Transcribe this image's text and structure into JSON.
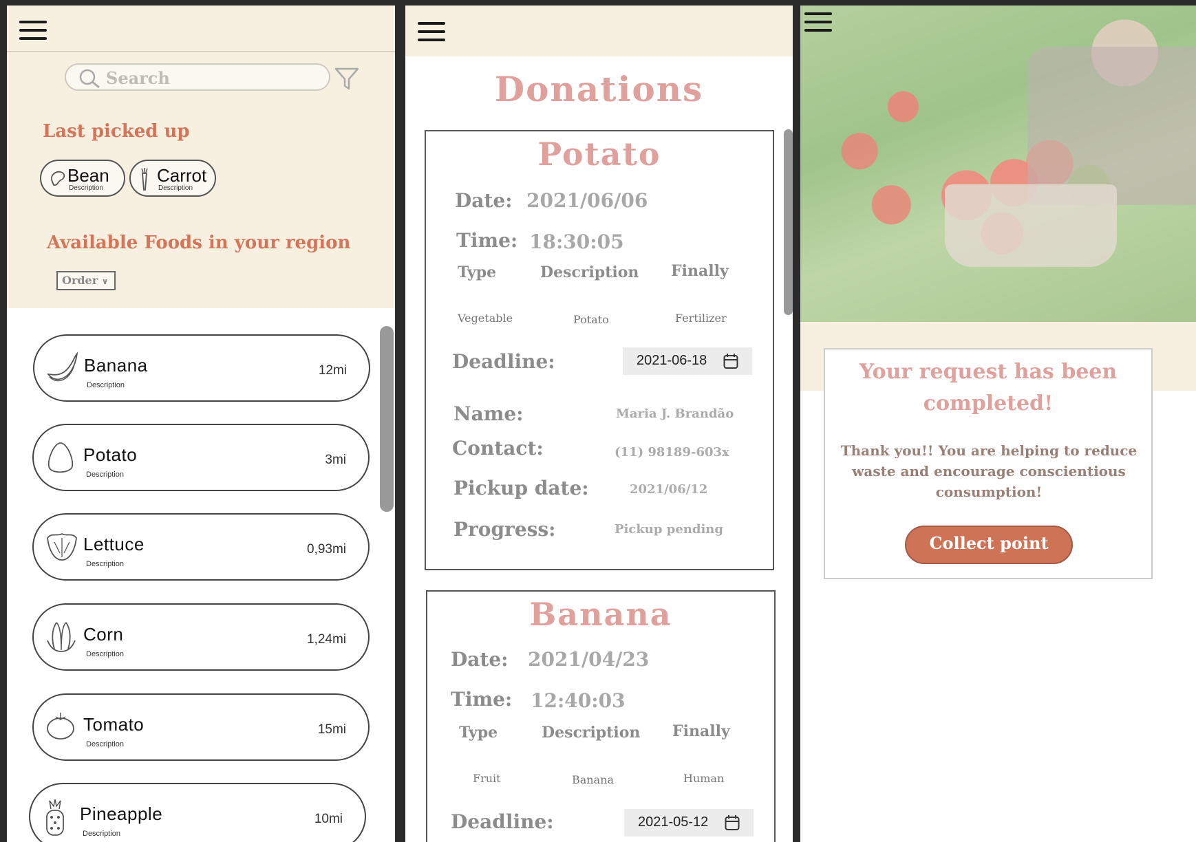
{
  "left": {
    "search": {
      "placeholder": "Search"
    },
    "last_picked_heading": "Last picked up",
    "recent": [
      {
        "name": "Bean",
        "desc": "Description"
      },
      {
        "name": "Carrot",
        "desc": "Description"
      }
    ],
    "available_heading": "Available Foods in your region",
    "order_label": "Order",
    "foods": [
      {
        "name": "Banana",
        "desc": "Description",
        "distance": "12mi"
      },
      {
        "name": "Potato",
        "desc": "Description",
        "distance": "3mi"
      },
      {
        "name": "Lettuce",
        "desc": "Description",
        "distance": "0,93mi"
      },
      {
        "name": "Corn",
        "desc": "Description",
        "distance": "1,24mi"
      },
      {
        "name": "Tomato",
        "desc": "Description",
        "distance": "15mi"
      },
      {
        "name": "Pineapple",
        "desc": "Description",
        "distance": "10mi"
      }
    ]
  },
  "mid": {
    "title": "Donations",
    "labels": {
      "date": "Date:",
      "time": "Time:",
      "type": "Type",
      "description": "Description",
      "finally": "Finally",
      "deadline": "Deadline:",
      "name": "Name:",
      "contact": "Contact:",
      "pickup_date": "Pickup date:",
      "progress": "Progress:"
    },
    "donations": [
      {
        "title": "Potato",
        "date": "2021/06/06",
        "time": "18:30:05",
        "type": "Vegetable",
        "description": "Potato",
        "finally": "Fertilizer",
        "deadline": "2021-06-18",
        "name": "Maria J. Brandão",
        "contact": "(11) 98189-603x",
        "pickup_date": "2021/06/12",
        "progress": "Pickup pending"
      },
      {
        "title": "Banana",
        "date": "2021/04/23",
        "time": "12:40:03",
        "type": "Fruit",
        "description": "Banana",
        "finally": "Human",
        "deadline": "2021-05-12"
      }
    ]
  },
  "right": {
    "confirm_title": "Your request has been completed!",
    "confirm_message": "Thank you!! You are helping to reduce waste and encourage conscientious consumption!",
    "collect_button": "Collect point"
  }
}
